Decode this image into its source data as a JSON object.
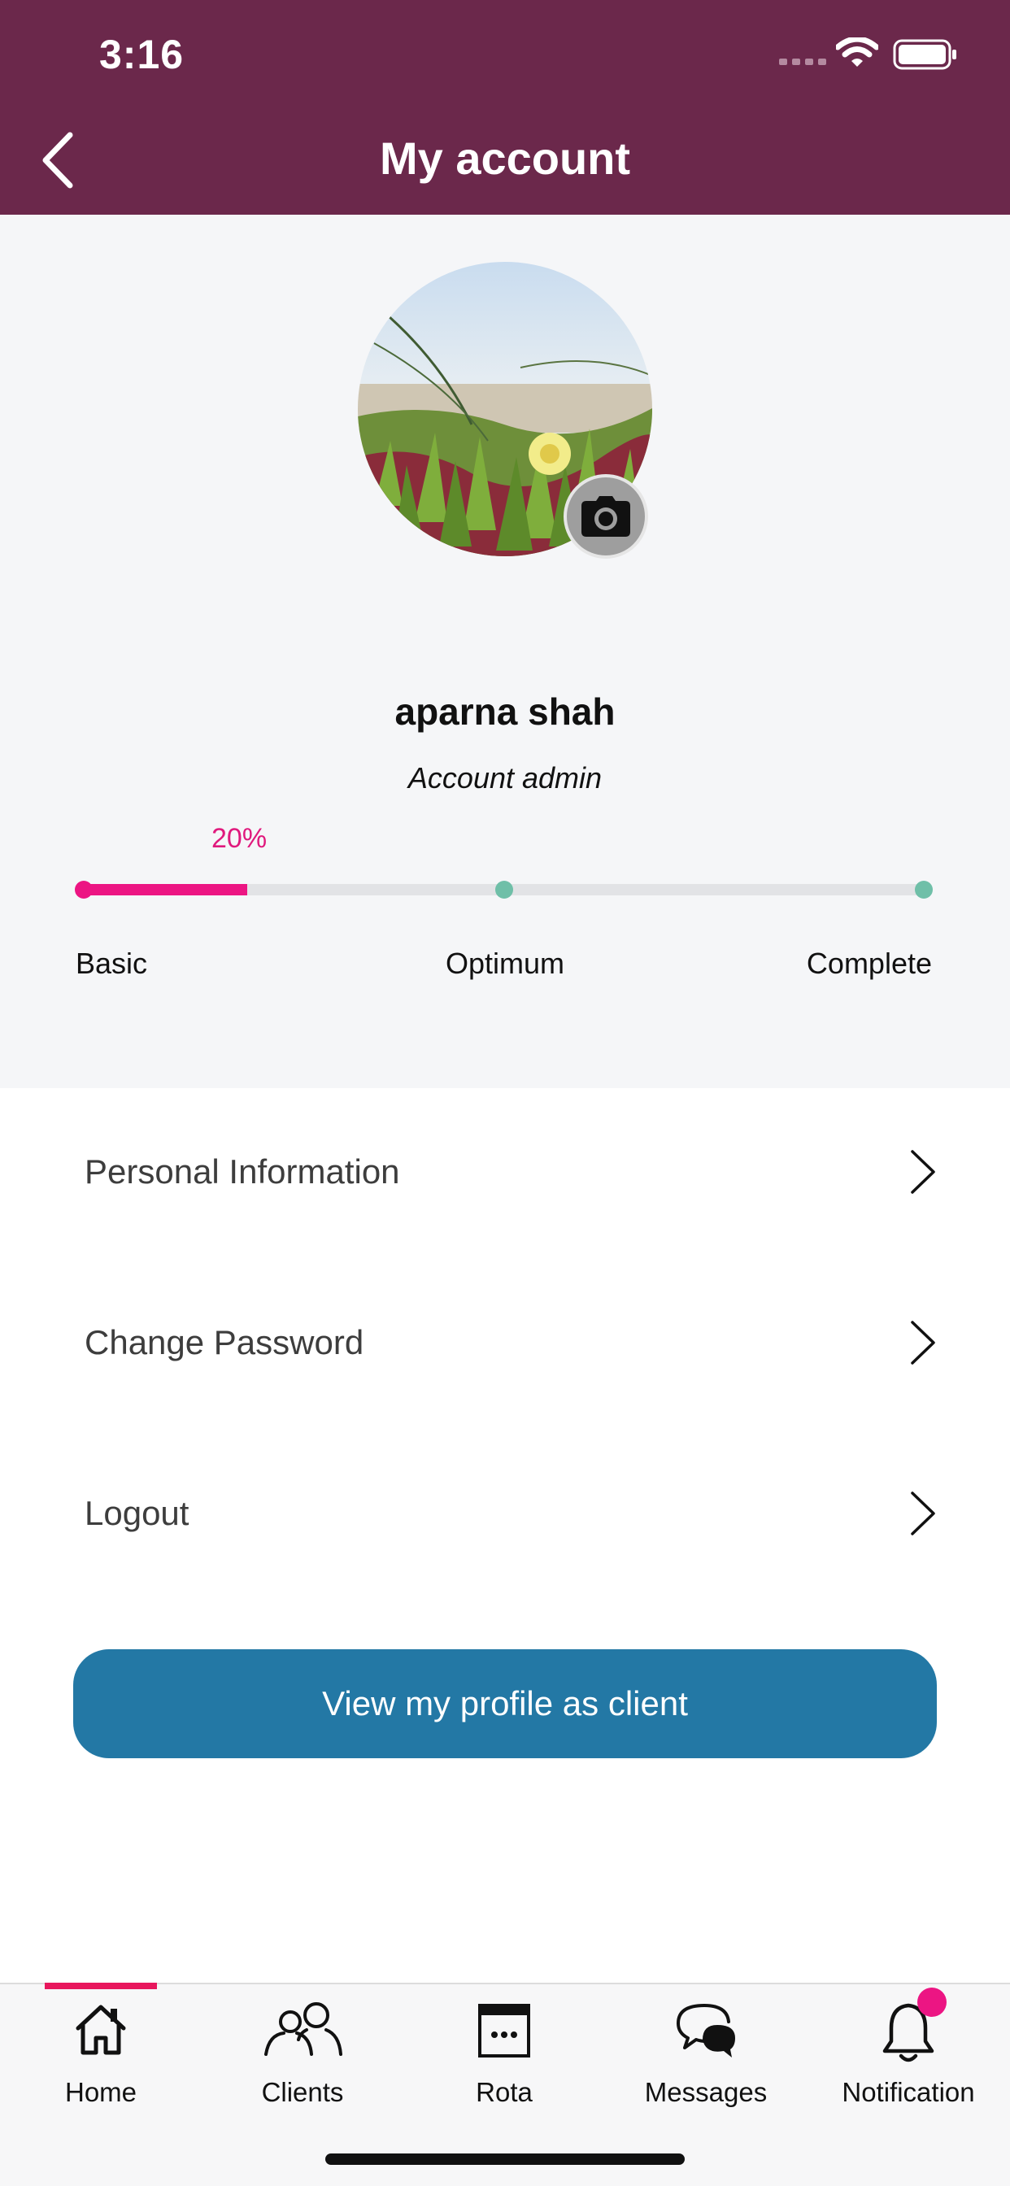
{
  "status_bar": {
    "time": "3:16"
  },
  "header": {
    "title": "My account"
  },
  "profile": {
    "name": "aparna shah",
    "role": "Account admin",
    "completion_percent_label": "20%",
    "completion_fraction": 0.2,
    "milestones": [
      "Basic",
      "Optimum",
      "Complete"
    ]
  },
  "menu": {
    "items": [
      {
        "label": "Personal Information"
      },
      {
        "label": "Change Password"
      },
      {
        "label": "Logout"
      }
    ]
  },
  "profile_button": {
    "label": "View my profile as client"
  },
  "tabbar": {
    "tabs": [
      {
        "label": "Home",
        "icon": "home-icon",
        "active": true
      },
      {
        "label": "Clients",
        "icon": "users-icon",
        "active": false
      },
      {
        "label": "Rota",
        "icon": "calendar-icon",
        "active": false
      },
      {
        "label": "Messages",
        "icon": "chat-icon",
        "active": false
      },
      {
        "label": "Notification",
        "icon": "bell-icon",
        "active": false
      }
    ]
  },
  "colors": {
    "header": "#6b284b",
    "accent_pink": "#ec1583",
    "milestone_green": "#6fbfa8",
    "button_blue": "#2378a5"
  }
}
